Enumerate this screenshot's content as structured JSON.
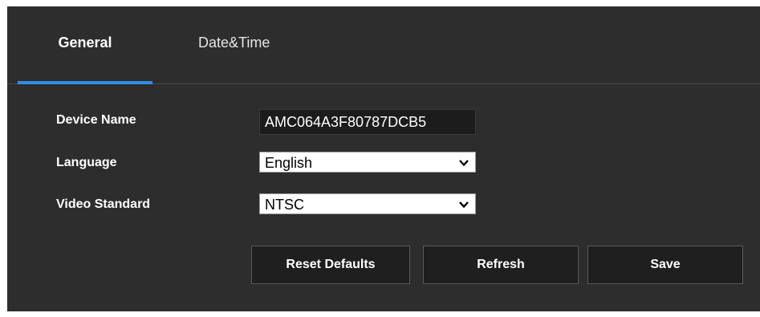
{
  "tabs": {
    "general_label": "General",
    "datetime_label": "Date&Time",
    "active": "General"
  },
  "form": {
    "device_name": {
      "label": "Device Name",
      "value": "AMC064A3F80787DCB5"
    },
    "language": {
      "label": "Language",
      "selected": "English"
    },
    "video_standard": {
      "label": "Video Standard",
      "selected": "NTSC"
    }
  },
  "buttons": {
    "reset_label": "Reset Defaults",
    "refresh_label": "Refresh",
    "save_label": "Save"
  },
  "colors": {
    "panel_bg": "#2d2d2d",
    "active_tab_underline": "#2f8de4",
    "button_bg": "#1f1f1f"
  },
  "icons": {
    "dropdown": "chevron-down-icon"
  }
}
